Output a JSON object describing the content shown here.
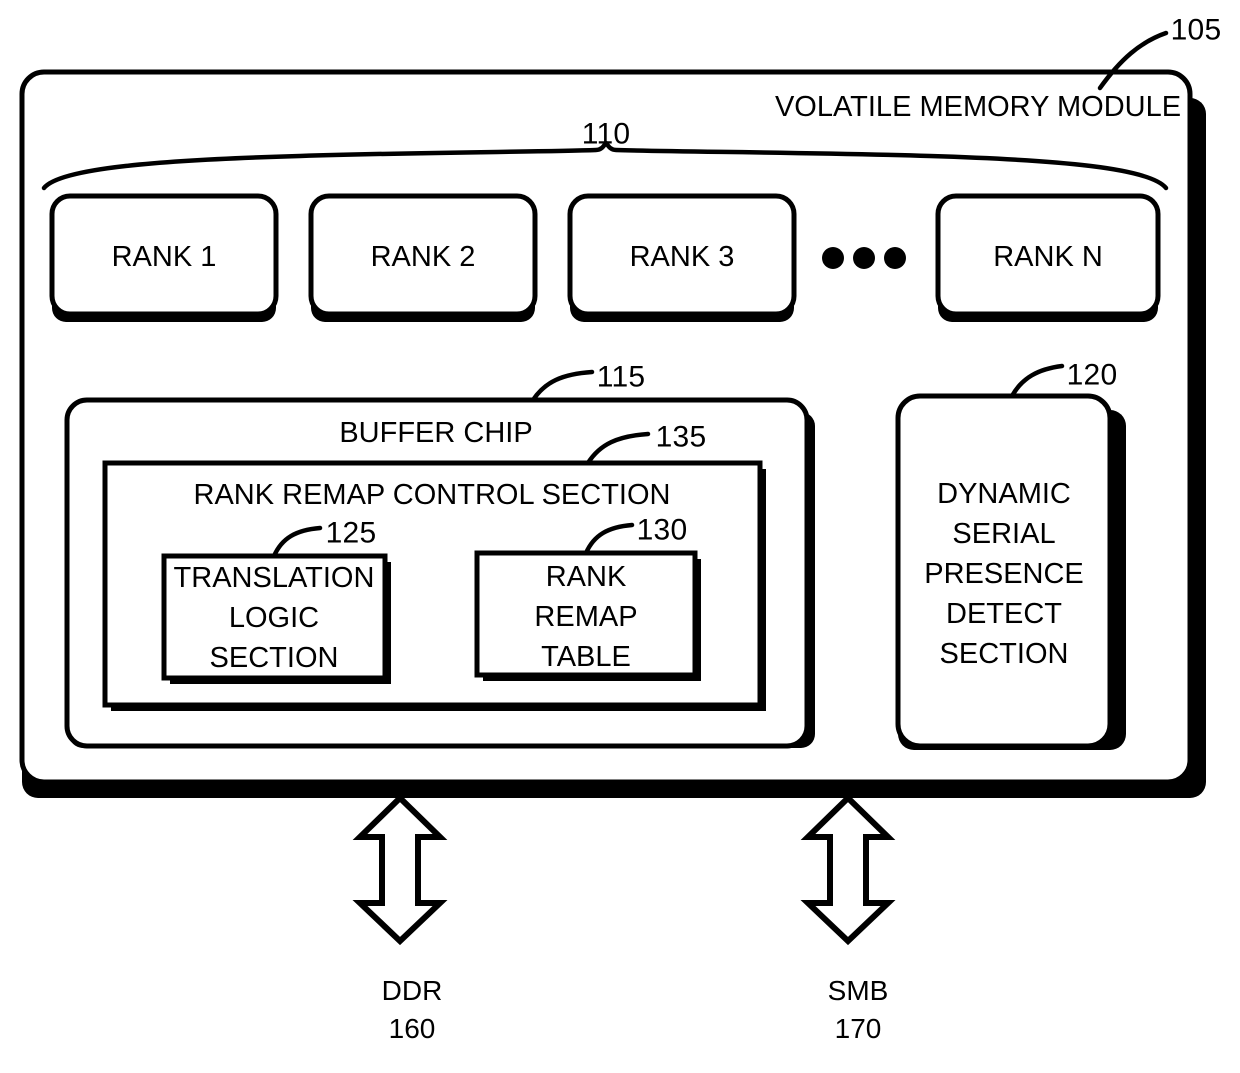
{
  "figure": {
    "type": "patent-block-diagram",
    "module": {
      "title": "VOLATILE MEMORY MODULE",
      "ref": "105"
    },
    "ranks": {
      "ref": "110",
      "items": [
        {
          "label": "RANK 1"
        },
        {
          "label": "RANK 2"
        },
        {
          "label": "RANK 3"
        },
        {
          "label": "RANK N"
        }
      ],
      "ellipsis": "•••"
    },
    "buffer_chip": {
      "title": "BUFFER CHIP",
      "ref": "115",
      "rank_remap_control": {
        "title": "RANK REMAP CONTROL SECTION",
        "ref": "135",
        "blocks": [
          {
            "ref": "125",
            "lines": [
              "TRANSLATION",
              "LOGIC",
              "SECTION"
            ]
          },
          {
            "ref": "130",
            "lines": [
              "RANK",
              "REMAP",
              "TABLE"
            ]
          }
        ]
      }
    },
    "dspd": {
      "ref": "120",
      "lines": [
        "DYNAMIC",
        "SERIAL",
        "PRESENCE",
        "DETECT",
        "SECTION"
      ]
    },
    "buses": [
      {
        "name": "DDR",
        "ref": "160",
        "arrow": "double-vertical-arrow"
      },
      {
        "name": "SMB",
        "ref": "170",
        "arrow": "double-vertical-arrow"
      }
    ],
    "colors": {
      "stroke": "#000000",
      "fill": "#ffffff",
      "shadow": "#000000"
    }
  }
}
